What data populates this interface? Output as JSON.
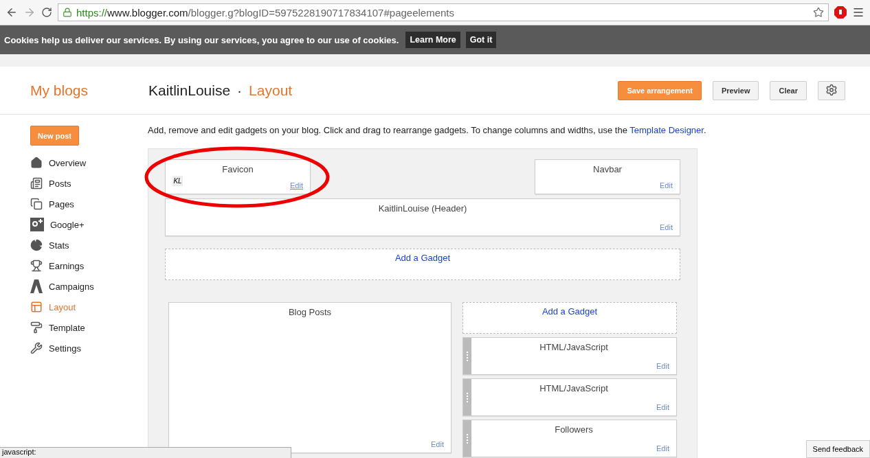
{
  "browser": {
    "url": {
      "scheme": "https://",
      "host": "www.blogger.com",
      "path": "/blogger.g?blogID=5975228190717834107#pageelements"
    }
  },
  "cookie_bar": {
    "message": "Cookies help us deliver our services. By using our services, you agree to our use of cookies.",
    "buttons": [
      "Learn More",
      "Got it"
    ]
  },
  "header": {
    "my_blogs": "My blogs",
    "blog_name": "KaitlinLouise",
    "separator": "·",
    "page": "Layout",
    "buttons": [
      {
        "label": "Save arrangement",
        "kind": "primary"
      },
      {
        "label": "Preview",
        "kind": "plain"
      },
      {
        "label": "Clear",
        "kind": "plain"
      }
    ]
  },
  "sidebar": {
    "new_post": "New post",
    "items": [
      {
        "label": "Overview",
        "selected": false
      },
      {
        "label": "Posts",
        "selected": false
      },
      {
        "label": "Pages",
        "selected": false
      },
      {
        "label": "Google+",
        "selected": false
      },
      {
        "label": "Stats",
        "selected": false
      },
      {
        "label": "Earnings",
        "selected": false
      },
      {
        "label": "Campaigns",
        "selected": false
      },
      {
        "label": "Layout",
        "selected": true
      },
      {
        "label": "Template",
        "selected": false
      },
      {
        "label": "Settings",
        "selected": false
      }
    ]
  },
  "intro": {
    "text": "Add, remove and edit gadgets on your blog. Click and drag to rearrange gadgets. To change columns and widths, use the",
    "link": "Template Designer",
    "end": "."
  },
  "layout": {
    "favicon": {
      "title": "Favicon",
      "thumb": "KL",
      "edit": "Edit"
    },
    "navbar": {
      "title": "Navbar",
      "edit": "Edit"
    },
    "header_gadget": {
      "title": "KaitlinLouise (Header)",
      "edit": "Edit"
    },
    "add_top": "Add a Gadget",
    "main": {
      "title": "Blog Posts",
      "edit": "Edit"
    },
    "side_add": "Add a Gadget",
    "side": [
      {
        "title": "HTML/JavaScript",
        "edit": "Edit"
      },
      {
        "title": "HTML/JavaScript",
        "edit": "Edit"
      },
      {
        "title": "Followers",
        "edit": "Edit"
      }
    ]
  },
  "status": "javascript:",
  "feedback": "Send feedback"
}
